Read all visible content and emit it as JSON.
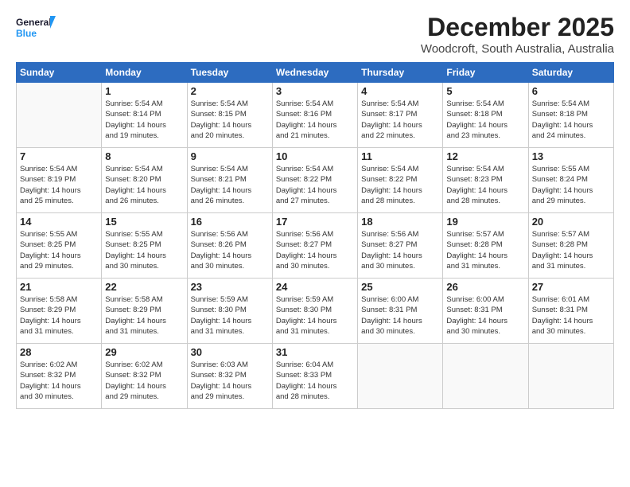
{
  "logo": {
    "line1": "General",
    "line2": "Blue"
  },
  "title": "December 2025",
  "subtitle": "Woodcroft, South Australia, Australia",
  "days_of_week": [
    "Sunday",
    "Monday",
    "Tuesday",
    "Wednesday",
    "Thursday",
    "Friday",
    "Saturday"
  ],
  "weeks": [
    [
      {
        "day": "",
        "info": ""
      },
      {
        "day": "1",
        "info": "Sunrise: 5:54 AM\nSunset: 8:14 PM\nDaylight: 14 hours\nand 19 minutes."
      },
      {
        "day": "2",
        "info": "Sunrise: 5:54 AM\nSunset: 8:15 PM\nDaylight: 14 hours\nand 20 minutes."
      },
      {
        "day": "3",
        "info": "Sunrise: 5:54 AM\nSunset: 8:16 PM\nDaylight: 14 hours\nand 21 minutes."
      },
      {
        "day": "4",
        "info": "Sunrise: 5:54 AM\nSunset: 8:17 PM\nDaylight: 14 hours\nand 22 minutes."
      },
      {
        "day": "5",
        "info": "Sunrise: 5:54 AM\nSunset: 8:18 PM\nDaylight: 14 hours\nand 23 minutes."
      },
      {
        "day": "6",
        "info": "Sunrise: 5:54 AM\nSunset: 8:18 PM\nDaylight: 14 hours\nand 24 minutes."
      }
    ],
    [
      {
        "day": "7",
        "info": "Sunrise: 5:54 AM\nSunset: 8:19 PM\nDaylight: 14 hours\nand 25 minutes."
      },
      {
        "day": "8",
        "info": "Sunrise: 5:54 AM\nSunset: 8:20 PM\nDaylight: 14 hours\nand 26 minutes."
      },
      {
        "day": "9",
        "info": "Sunrise: 5:54 AM\nSunset: 8:21 PM\nDaylight: 14 hours\nand 26 minutes."
      },
      {
        "day": "10",
        "info": "Sunrise: 5:54 AM\nSunset: 8:22 PM\nDaylight: 14 hours\nand 27 minutes."
      },
      {
        "day": "11",
        "info": "Sunrise: 5:54 AM\nSunset: 8:22 PM\nDaylight: 14 hours\nand 28 minutes."
      },
      {
        "day": "12",
        "info": "Sunrise: 5:54 AM\nSunset: 8:23 PM\nDaylight: 14 hours\nand 28 minutes."
      },
      {
        "day": "13",
        "info": "Sunrise: 5:55 AM\nSunset: 8:24 PM\nDaylight: 14 hours\nand 29 minutes."
      }
    ],
    [
      {
        "day": "14",
        "info": "Sunrise: 5:55 AM\nSunset: 8:25 PM\nDaylight: 14 hours\nand 29 minutes."
      },
      {
        "day": "15",
        "info": "Sunrise: 5:55 AM\nSunset: 8:25 PM\nDaylight: 14 hours\nand 30 minutes."
      },
      {
        "day": "16",
        "info": "Sunrise: 5:56 AM\nSunset: 8:26 PM\nDaylight: 14 hours\nand 30 minutes."
      },
      {
        "day": "17",
        "info": "Sunrise: 5:56 AM\nSunset: 8:27 PM\nDaylight: 14 hours\nand 30 minutes."
      },
      {
        "day": "18",
        "info": "Sunrise: 5:56 AM\nSunset: 8:27 PM\nDaylight: 14 hours\nand 30 minutes."
      },
      {
        "day": "19",
        "info": "Sunrise: 5:57 AM\nSunset: 8:28 PM\nDaylight: 14 hours\nand 31 minutes."
      },
      {
        "day": "20",
        "info": "Sunrise: 5:57 AM\nSunset: 8:28 PM\nDaylight: 14 hours\nand 31 minutes."
      }
    ],
    [
      {
        "day": "21",
        "info": "Sunrise: 5:58 AM\nSunset: 8:29 PM\nDaylight: 14 hours\nand 31 minutes."
      },
      {
        "day": "22",
        "info": "Sunrise: 5:58 AM\nSunset: 8:29 PM\nDaylight: 14 hours\nand 31 minutes."
      },
      {
        "day": "23",
        "info": "Sunrise: 5:59 AM\nSunset: 8:30 PM\nDaylight: 14 hours\nand 31 minutes."
      },
      {
        "day": "24",
        "info": "Sunrise: 5:59 AM\nSunset: 8:30 PM\nDaylight: 14 hours\nand 31 minutes."
      },
      {
        "day": "25",
        "info": "Sunrise: 6:00 AM\nSunset: 8:31 PM\nDaylight: 14 hours\nand 30 minutes."
      },
      {
        "day": "26",
        "info": "Sunrise: 6:00 AM\nSunset: 8:31 PM\nDaylight: 14 hours\nand 30 minutes."
      },
      {
        "day": "27",
        "info": "Sunrise: 6:01 AM\nSunset: 8:31 PM\nDaylight: 14 hours\nand 30 minutes."
      }
    ],
    [
      {
        "day": "28",
        "info": "Sunrise: 6:02 AM\nSunset: 8:32 PM\nDaylight: 14 hours\nand 30 minutes."
      },
      {
        "day": "29",
        "info": "Sunrise: 6:02 AM\nSunset: 8:32 PM\nDaylight: 14 hours\nand 29 minutes."
      },
      {
        "day": "30",
        "info": "Sunrise: 6:03 AM\nSunset: 8:32 PM\nDaylight: 14 hours\nand 29 minutes."
      },
      {
        "day": "31",
        "info": "Sunrise: 6:04 AM\nSunset: 8:33 PM\nDaylight: 14 hours\nand 28 minutes."
      },
      {
        "day": "",
        "info": ""
      },
      {
        "day": "",
        "info": ""
      },
      {
        "day": "",
        "info": ""
      }
    ]
  ]
}
